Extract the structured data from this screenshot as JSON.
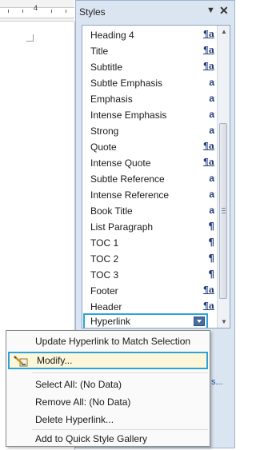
{
  "ruler": {
    "number": "4"
  },
  "pane": {
    "title": "Styles",
    "chevron": "▼",
    "close": "✕"
  },
  "styles": [
    {
      "name": "Heading 4",
      "symbol": "¶a",
      "kind": "linked"
    },
    {
      "name": "Title",
      "symbol": "¶a",
      "kind": "linked"
    },
    {
      "name": "Subtitle",
      "symbol": "¶a",
      "kind": "linked"
    },
    {
      "name": "Subtle Emphasis",
      "symbol": "a",
      "kind": "char"
    },
    {
      "name": "Emphasis",
      "symbol": "a",
      "kind": "char"
    },
    {
      "name": "Intense Emphasis",
      "symbol": "a",
      "kind": "char"
    },
    {
      "name": "Strong",
      "symbol": "a",
      "kind": "char"
    },
    {
      "name": "Quote",
      "symbol": "¶a",
      "kind": "linked"
    },
    {
      "name": "Intense Quote",
      "symbol": "¶a",
      "kind": "linked"
    },
    {
      "name": "Subtle Reference",
      "symbol": "a",
      "kind": "char"
    },
    {
      "name": "Intense Reference",
      "symbol": "a",
      "kind": "char"
    },
    {
      "name": "Book Title",
      "symbol": "a",
      "kind": "char"
    },
    {
      "name": "List Paragraph",
      "symbol": "¶",
      "kind": "para"
    },
    {
      "name": "TOC 1",
      "symbol": "¶",
      "kind": "para"
    },
    {
      "name": "TOC 2",
      "symbol": "¶",
      "kind": "para"
    },
    {
      "name": "TOC 3",
      "symbol": "¶",
      "kind": "para"
    },
    {
      "name": "Footer",
      "symbol": "¶a",
      "kind": "linked"
    },
    {
      "name": "Header",
      "symbol": "¶a",
      "kind": "linked"
    }
  ],
  "selected_style": {
    "name": "Hyperlink"
  },
  "scrollbar": {
    "up": "▲",
    "down": "▼"
  },
  "context_menu": {
    "items": [
      {
        "label": "Update Hyperlink to Match Selection"
      },
      {
        "label": "Modify..."
      },
      {
        "label": "Select All: (No Data)"
      },
      {
        "label": "Remove All: (No Data)"
      },
      {
        "label": "Delete Hyperlink..."
      },
      {
        "label": "Add to Quick Style Gallery"
      }
    ],
    "highlighted_index": 1
  },
  "pane_link_fragment": "s...",
  "colors": {
    "pane_bg": "#dbe5f1",
    "highlight_border": "#2ea3da",
    "symbol": "#1f3a7a"
  }
}
